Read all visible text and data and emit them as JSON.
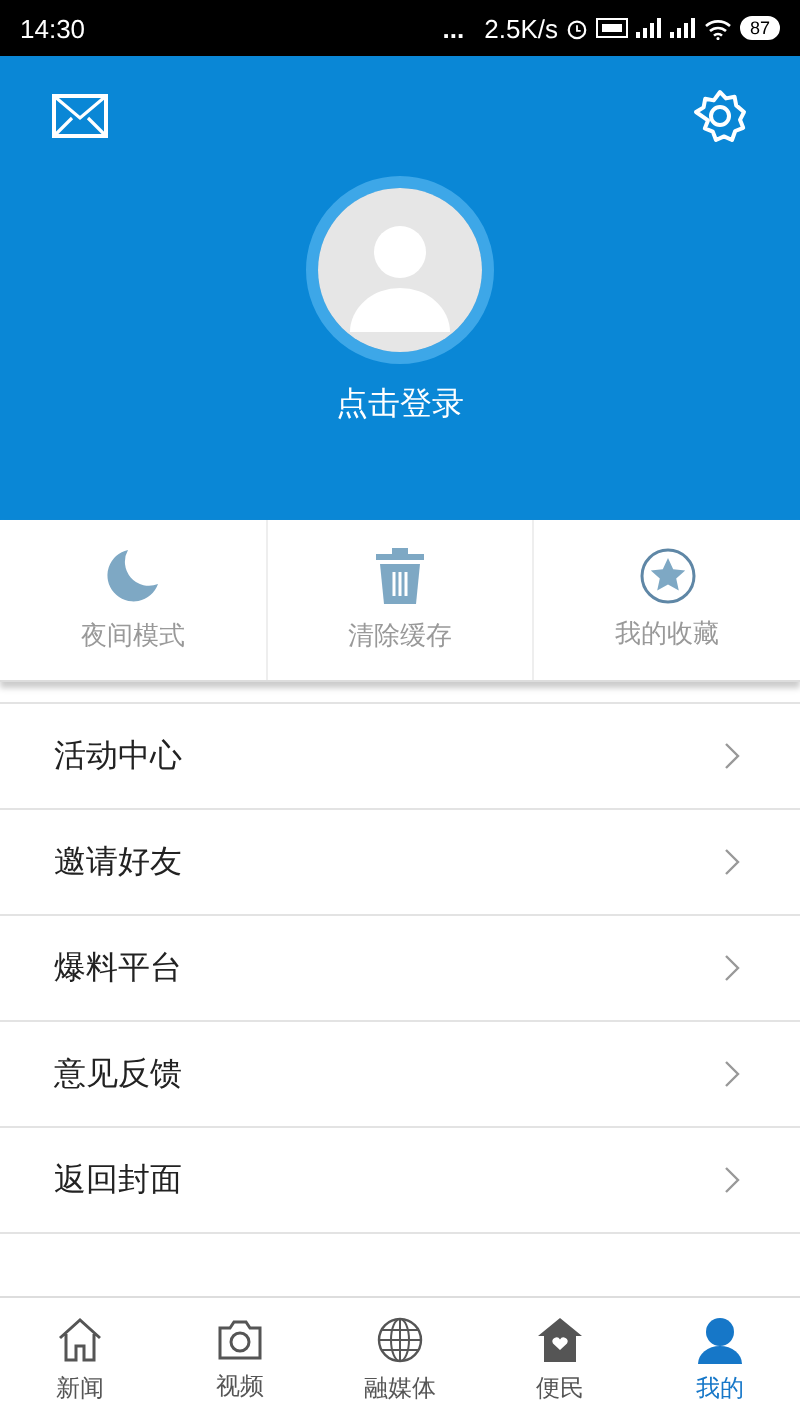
{
  "status_bar": {
    "time": "14:30",
    "dots": "...",
    "speed": "2.5K/s",
    "battery": "87"
  },
  "header": {
    "login": "点击登录"
  },
  "quick_actions": [
    {
      "kind": "moon",
      "label": "夜间模式"
    },
    {
      "kind": "trash",
      "label": "清除缓存"
    },
    {
      "kind": "star",
      "label": "我的收藏"
    }
  ],
  "menu": [
    "活动中心",
    "邀请好友",
    "爆料平台",
    "意见反馈",
    "返回封面"
  ],
  "tabs": [
    {
      "kind": "home",
      "label": "新闻",
      "selected": false
    },
    {
      "kind": "camera",
      "label": "视频",
      "selected": false
    },
    {
      "kind": "globe",
      "label": "融媒体",
      "selected": false
    },
    {
      "kind": "house",
      "label": "便民",
      "selected": false
    },
    {
      "kind": "person",
      "label": "我的",
      "selected": true
    }
  ]
}
